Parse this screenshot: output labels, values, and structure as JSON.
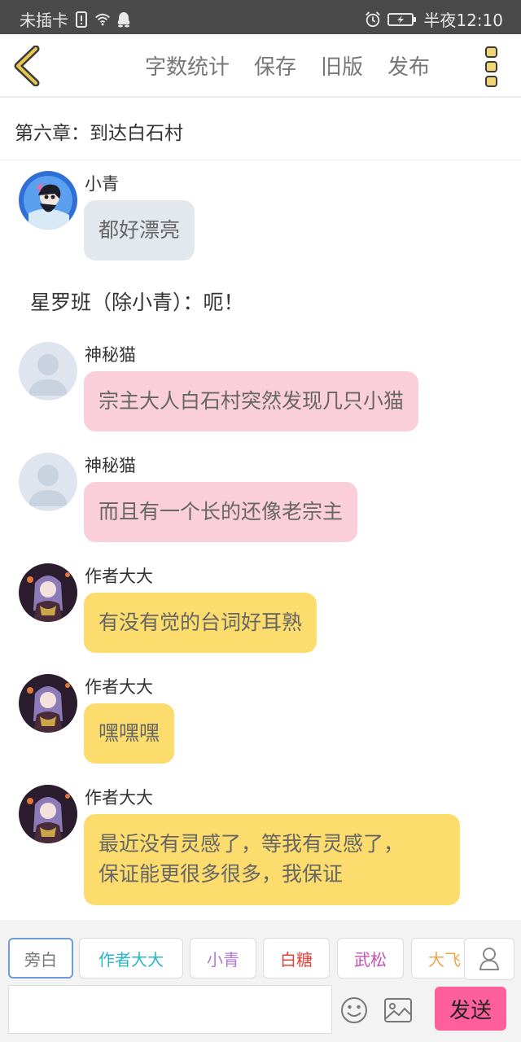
{
  "status_bar": {
    "carrier": "未插卡",
    "time": "半夜12:10",
    "colors": {
      "background": "#4a4a4a",
      "text": "#e8e8e8"
    },
    "icons": [
      "sim-alert-icon",
      "wifi-icon",
      "qq-icon",
      "alarm-icon",
      "battery-charging-icon"
    ]
  },
  "toolbar": {
    "back_icon": "chevron-left-icon",
    "word_count": "字数统计",
    "save": "保存",
    "old_version": "旧版",
    "publish": "发布",
    "menu_icon": "vertical-dots-icon",
    "accent": "#d9bd45"
  },
  "chapter": {
    "title": "第六章：到达白石村"
  },
  "narration": {
    "text": "星罗班（除小青）：呃！"
  },
  "messages": [
    {
      "sender": "小青",
      "avatar": "anime-girl-blue-avatar",
      "lines": [
        "都好漂亮"
      ],
      "bubble_color": "#e3e8ef"
    },
    {
      "sender": "神秘猫",
      "avatar": "default-user-avatar",
      "lines": [
        "宗主大人白石村突然发现几只小猫"
      ],
      "bubble_color": "#fbcfd9"
    },
    {
      "sender": "神秘猫",
      "avatar": "default-user-avatar",
      "lines": [
        "而且有一个长的还像老宗主"
      ],
      "bubble_color": "#fbcfd9"
    },
    {
      "sender": "作者大大",
      "avatar": "anime-girl-purple-avatar",
      "lines": [
        "有没有觉的台词好耳熟"
      ],
      "bubble_color": "#fbdc6c"
    },
    {
      "sender": "作者大大",
      "avatar": "anime-girl-purple-avatar",
      "lines": [
        "嘿嘿嘿"
      ],
      "bubble_color": "#fbdc6c"
    },
    {
      "sender": "作者大大",
      "avatar": "anime-girl-purple-avatar",
      "lines": [
        "最近没有灵感了，等我有灵感了，",
        "保证能更很多很多，我保证"
      ],
      "bubble_color": "#fbdc6c"
    }
  ],
  "roles": [
    {
      "label": "旁白",
      "color": "#777777",
      "active": true
    },
    {
      "label": "作者大大",
      "color": "#29b6c8",
      "active": false
    },
    {
      "label": "小青",
      "color": "#b07ad6",
      "active": false
    },
    {
      "label": "白糖",
      "color": "#e0413c",
      "active": false
    },
    {
      "label": "武松",
      "color": "#c74db4",
      "active": false
    },
    {
      "label": "大飞",
      "color": "#f0a34a",
      "active": false
    }
  ],
  "compose": {
    "placeholder": "",
    "role_icon": "person-icon",
    "emoji_icon": "smiley-icon",
    "image_icon": "image-icon",
    "send": "发送",
    "send_color": "#ff5f9b"
  }
}
